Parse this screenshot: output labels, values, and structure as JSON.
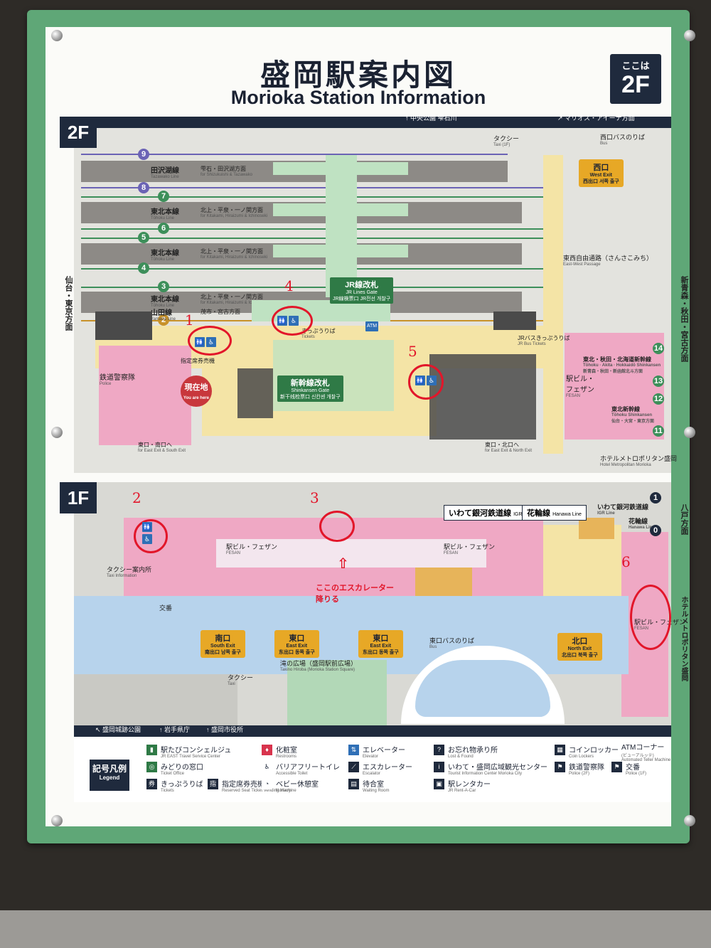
{
  "title": {
    "jp": "盛岡駅案内図",
    "en": "Morioka Station Information"
  },
  "here_badge": {
    "small": "ここは",
    "floor": "2F"
  },
  "floors": {
    "upper": "2F",
    "lower": "1F"
  },
  "top_directions": {
    "central_park": "中央公園",
    "central_park_en": "Central Park",
    "shizukuishi": "雫石川",
    "shizukuishi_en": "Shizukuishi River",
    "malios": "マリオス・アイーナ方面",
    "malios_en": "for MALIOS & aiina",
    "taxi": "タクシー",
    "taxi_en": "Taxi (1F)",
    "west_bus": "西口バスのりば",
    "west_bus_en": "Bus"
  },
  "lines": [
    {
      "num": "9",
      "color": "purple",
      "name": "",
      "dest": ""
    },
    {
      "num": "",
      "color": "",
      "name": "田沢湖線",
      "name_en": "Tazawako Line",
      "dest": "雫石・田沢湖方面",
      "dest_en": "for Shizukuishi & Tazawako"
    },
    {
      "num": "8",
      "color": "purple"
    },
    {
      "num": "7",
      "color": "green"
    },
    {
      "num": "",
      "name": "東北本線",
      "name_en": "Tōhoku Line",
      "dest": "北上・平泉・一ノ関方面",
      "dest_en": "for Kitakami, Hiraizumi & Ichinoseki"
    },
    {
      "num": "6",
      "color": "green"
    },
    {
      "num": "5",
      "color": "green"
    },
    {
      "num": "",
      "name": "東北本線",
      "name_en": "Tōhoku Line",
      "dest": "北上・平泉・一ノ関方面",
      "dest_en": "for Kitakami, Hiraizumi & Ichinoseki"
    },
    {
      "num": "4",
      "color": "green"
    },
    {
      "num": "3",
      "color": "green"
    },
    {
      "num": "",
      "name": "東北本線",
      "name_en": "Tōhoku Line",
      "dest": "北上・平泉・一ノ関方面",
      "dest_en": "for Kitakami, Hiraizumi & Ichinoseki"
    },
    {
      "num": "",
      "name": "山田線",
      "name_en": "Yamada Line",
      "dest": "茂市・宮古方面",
      "dest_en": "for Moichi & Miyako"
    },
    {
      "num": "2",
      "color": "orange"
    }
  ],
  "gates": {
    "jr": "JR線改札",
    "jr_en": "JR Lines Gate",
    "jr_sub": "JR線検票口 JR전선 개찰구",
    "shinkansen": "新幹線改札",
    "shinkansen_en": "Shinkansen Gate",
    "shinkansen_sub": "新干线检票口 신칸센 개찰구"
  },
  "labels_2f": {
    "west_exit": "西口",
    "west_exit_en": "West Exit",
    "west_exit_sub": "西出口 서쪽 출구",
    "passage": "東西自由通路（さんさこみち）",
    "passage_en": "East-West Passage",
    "tickets": "きっぷうりば",
    "tickets_en": "Tickets",
    "jr_bus": "JRバス",
    "jr_bus2": "きっぷうりば",
    "jr_bus_en": "JR Bus Tickets",
    "shinkansen_n": "東北・秋田・北海道新幹線",
    "shinkansen_n_en": "Tōhoku · Akita · Hokkaidō Shinkansen",
    "shinkansen_n_dest": "新青森・秋田・新函館北斗方面",
    "shinkansen_s": "東北新幹線",
    "shinkansen_s_en": "Tōhoku Shinkansen",
    "shinkansen_s_dest": "仙台・大宮・東京方面",
    "fesan": "駅ビル・",
    "fesan2": "フェザン",
    "fesan_en": "FESAN",
    "police": "鉄道警察隊",
    "police_en": "Police",
    "you_are_here": "現在地",
    "you_are_here_en": "You are here",
    "reserved": "指定席券売機",
    "east_south": "東口・南口へ",
    "east_south_en": "for East Exit & South Exit",
    "east_north": "東口・北口へ",
    "east_north_en": "for East Exit & North Exit",
    "hotel": "ホテルメトロポリタン盛岡",
    "hotel_en": "Hotel Metropolitan Morioka",
    "left_dir": "仙台・東京方面",
    "right_dir": "新青森・秋田・宮古方面",
    "atm": "ATM"
  },
  "platforms_right": [
    "14",
    "13",
    "12",
    "11"
  ],
  "labels_1f": {
    "igr": "いわて銀河鉄道線",
    "igr_en": "IGR Line",
    "hanawa": "花輪線",
    "hanawa_en": "Hanawa Line",
    "igr_right": "いわて銀河鉄道線",
    "igr_right_en": "IGR Line",
    "hanawa_right": "花輪線",
    "hanawa_right_en": "Hanawa Line",
    "hachinohe": "八戸方面",
    "fesan": "駅ビル・フェザン",
    "fesan_en": "FESAN",
    "taxi_info": "タクシー案内所",
    "taxi_info_en": "Taxi Information",
    "koban": "交番",
    "south_exit": "南口",
    "south_exit_en": "South Exit",
    "south_exit_sub": "南出口 남쪽 출구",
    "east_exit": "東口",
    "east_exit_en": "East Exit",
    "east_exit_sub": "东出口 동쪽 출구",
    "north_exit": "北口",
    "north_exit_en": "North Exit",
    "north_exit_sub": "北出口 북쪽 출구",
    "east_bus": "東口バスのりば",
    "east_bus_en": "Bus",
    "square": "滝の広場（盛岡駅前広場）",
    "square_en": "Takino Hiroba (Morioka Station Square)",
    "taxi": "タクシー",
    "taxi_en": "Taxi",
    "hotel_v": "ホテルメトロポリタン盛岡",
    "castle": "盛岡城跡公園",
    "castle_en": "Morioka Castle Site Park",
    "pref": "岩手県庁",
    "pref_en": "Iwate Prefectural office",
    "city": "盛岡市役所",
    "city_en": "Morioka City Hall",
    "platform1": "1",
    "platform0": "0"
  },
  "annotations": {
    "n1": "1",
    "n2": "2",
    "n3": "3",
    "n4": "4",
    "n5": "5",
    "n6": "6",
    "note_line1": "ここのエスカレーター",
    "note_line2": "降りる"
  },
  "legend": {
    "title": "記号凡例",
    "title_en": "Legend",
    "items": [
      {
        "jp": "駅たびコンシェルジュ",
        "en": "JR EAST Travel Service Center"
      },
      {
        "jp": "みどりの窓口",
        "en": "Ticket Office"
      },
      {
        "jp": "きっぷうりば",
        "en": "Tickets"
      },
      {
        "jp": "指定席券売機",
        "en": "Reserved Seat Ticket Vending Machine"
      },
      {
        "jp": "化粧室",
        "en": "Restrooms"
      },
      {
        "jp": "バリアフリートイレ",
        "en": "Accessible Toilet"
      },
      {
        "jp": "ベビー休憩室",
        "en": "Nursery"
      },
      {
        "jp": "エレベーター",
        "en": "Elevator"
      },
      {
        "jp": "エスカレーター",
        "en": "Escalator"
      },
      {
        "jp": "待合室",
        "en": "Waiting Room"
      },
      {
        "jp": "お忘れ物承り所",
        "en": "Lost & Found"
      },
      {
        "jp": "いわて・盛岡広域観光センター",
        "en": "Tourist Information Center Morioka City"
      },
      {
        "jp": "駅レンタカー",
        "en": "JR Rent-A-Car"
      },
      {
        "jp": "コインロッカー",
        "en": "Coin Lockers"
      },
      {
        "jp": "鉄道警察隊",
        "en": "Police (2F)"
      },
      {
        "jp": "交番",
        "en": "Police (1F)"
      },
      {
        "jp": "ATMコーナー",
        "en": "(ビューアルッテ)"
      },
      {
        "jp": "",
        "en": "Automated Teller Machine"
      }
    ]
  },
  "colors": {
    "frame": "#5fa777",
    "navy": "#1f2a3d",
    "annotation": "#e2162a"
  }
}
